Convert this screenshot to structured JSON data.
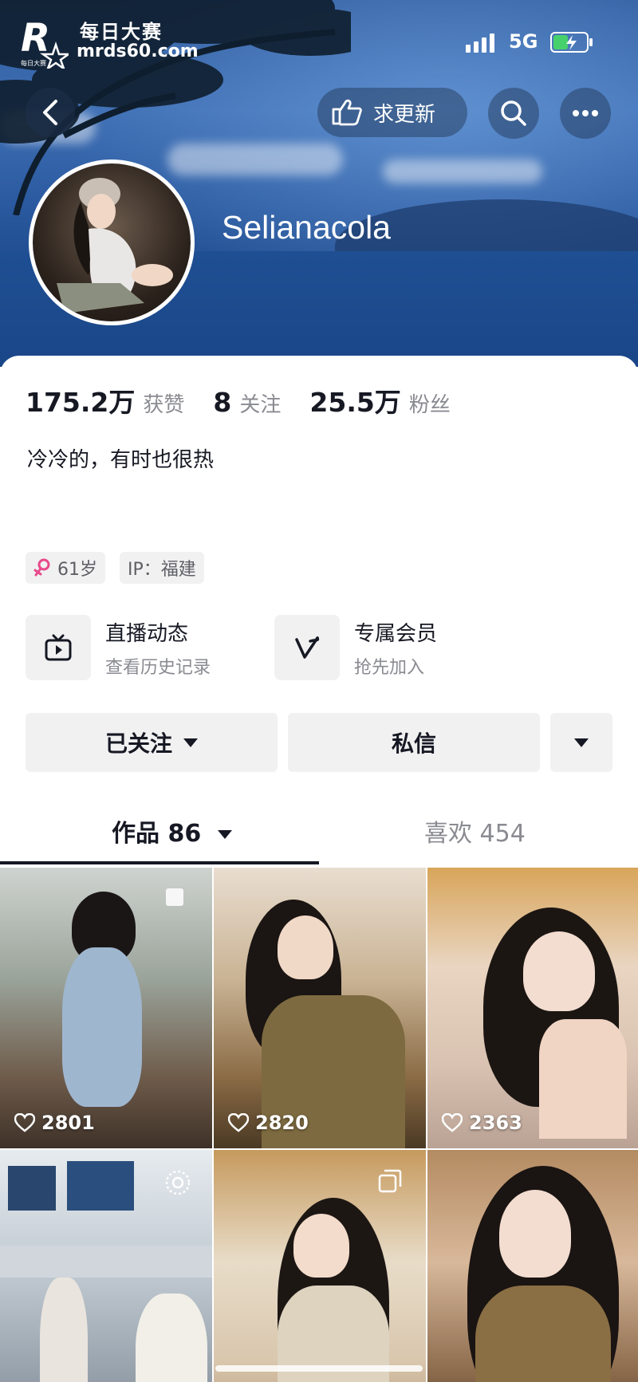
{
  "watermark": {
    "title": "每日大赛",
    "url": "mrds60.com",
    "logo_letter": "R",
    "logo_sub": "每日大赛"
  },
  "status_bar": {
    "network": "5G"
  },
  "header": {
    "request_update_label": "求更新"
  },
  "profile": {
    "username": "Selianacola",
    "stats": [
      {
        "value": "175.2万",
        "label": "获赞"
      },
      {
        "value": "8",
        "label": "关注"
      },
      {
        "value": "25.5万",
        "label": "粉丝"
      }
    ],
    "bio": "冷冷的，有时也很热",
    "tags": {
      "age": "61岁",
      "ip": "IP：福建"
    }
  },
  "features": [
    {
      "title": "直播动态",
      "subtitle": "查看历史记录",
      "icon": "tv-icon"
    },
    {
      "title": "专属会员",
      "subtitle": "抢先加入",
      "icon": "v-icon"
    }
  ],
  "actions": {
    "follow_label": "已关注",
    "message_label": "私信"
  },
  "tabs": {
    "works_label": "作品 86",
    "likes_label": "喜欢 454"
  },
  "videos": [
    {
      "likes": "2801"
    },
    {
      "likes": "2820"
    },
    {
      "likes": "2363"
    }
  ],
  "colors": {
    "accent_pink": "#e84a8a",
    "text": "#161823",
    "muted": "#8a8b91",
    "chip_bg": "#f1f1f2"
  }
}
